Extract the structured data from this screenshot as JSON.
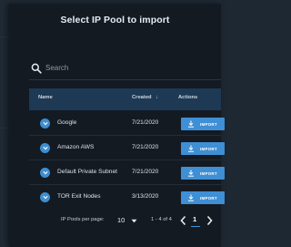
{
  "modal": {
    "title": "Select IP Pool to import"
  },
  "search": {
    "placeholder": "Search"
  },
  "table": {
    "headers": {
      "name": "Name",
      "created": "Created",
      "sort_indicator": "↓",
      "actions": "Actions"
    },
    "rows": [
      {
        "name": "Google",
        "created": "7/21/2020",
        "action": "IMPORT"
      },
      {
        "name": "Amazon AWS",
        "created": "7/21/2020",
        "action": "IMPORT"
      },
      {
        "name": "Default Private Subnet",
        "created": "7/21/2020",
        "action": "IMPORT"
      },
      {
        "name": "TOR Exit Nodes",
        "created": "3/13/2020",
        "action": "IMPORT"
      }
    ]
  },
  "pagination": {
    "per_page_label": "IP Pools per page:",
    "per_page_value": "10",
    "range_text": "1 - 4 of 4",
    "current_page": "1"
  },
  "colors": {
    "accent": "#3f8fd4",
    "header_bg": "#1d3954",
    "modal_bg": "#131a22"
  },
  "icons": {
    "search": "search-icon",
    "expand": "chevron-down-icon",
    "import": "download-icon",
    "caret": "caret-down-icon",
    "prev": "chevron-left-icon",
    "next": "chevron-right-icon"
  }
}
